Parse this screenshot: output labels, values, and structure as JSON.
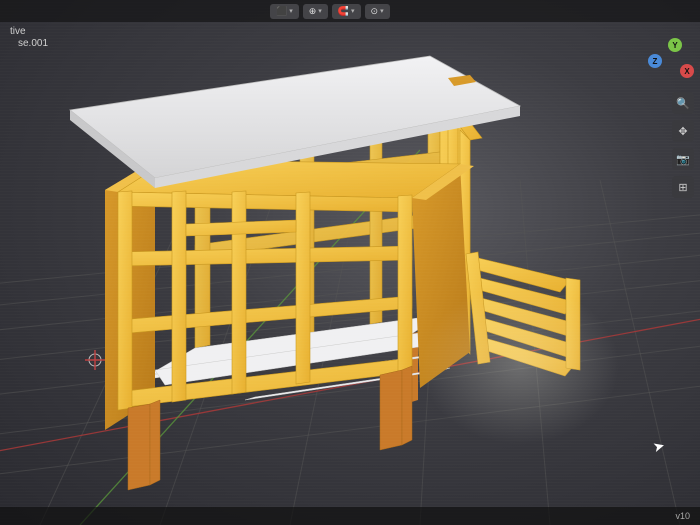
{
  "header": {
    "mode_btn": "⬛",
    "pivot_btn": "⊕",
    "snap_btn": "🧲",
    "overlay_btn": "⊙"
  },
  "outliner": {
    "mode": "tive",
    "object_name": "se.001"
  },
  "gizmo": {
    "x": "X",
    "y": "Y",
    "z": "Z"
  },
  "right_tools": {
    "zoom": "🔍",
    "move": "✥",
    "camera": "📷",
    "persp": "⊞"
  },
  "status": {
    "info": "v10"
  },
  "colors": {
    "wood_light": "#f5c542",
    "wood_shadow": "#d89a2a",
    "wood_dark": "#b87a1a",
    "roof": "#e8e8ea",
    "roof_shadow": "#c8c8ca",
    "post": "#c97a2a",
    "joist": "#f0f0f2"
  }
}
